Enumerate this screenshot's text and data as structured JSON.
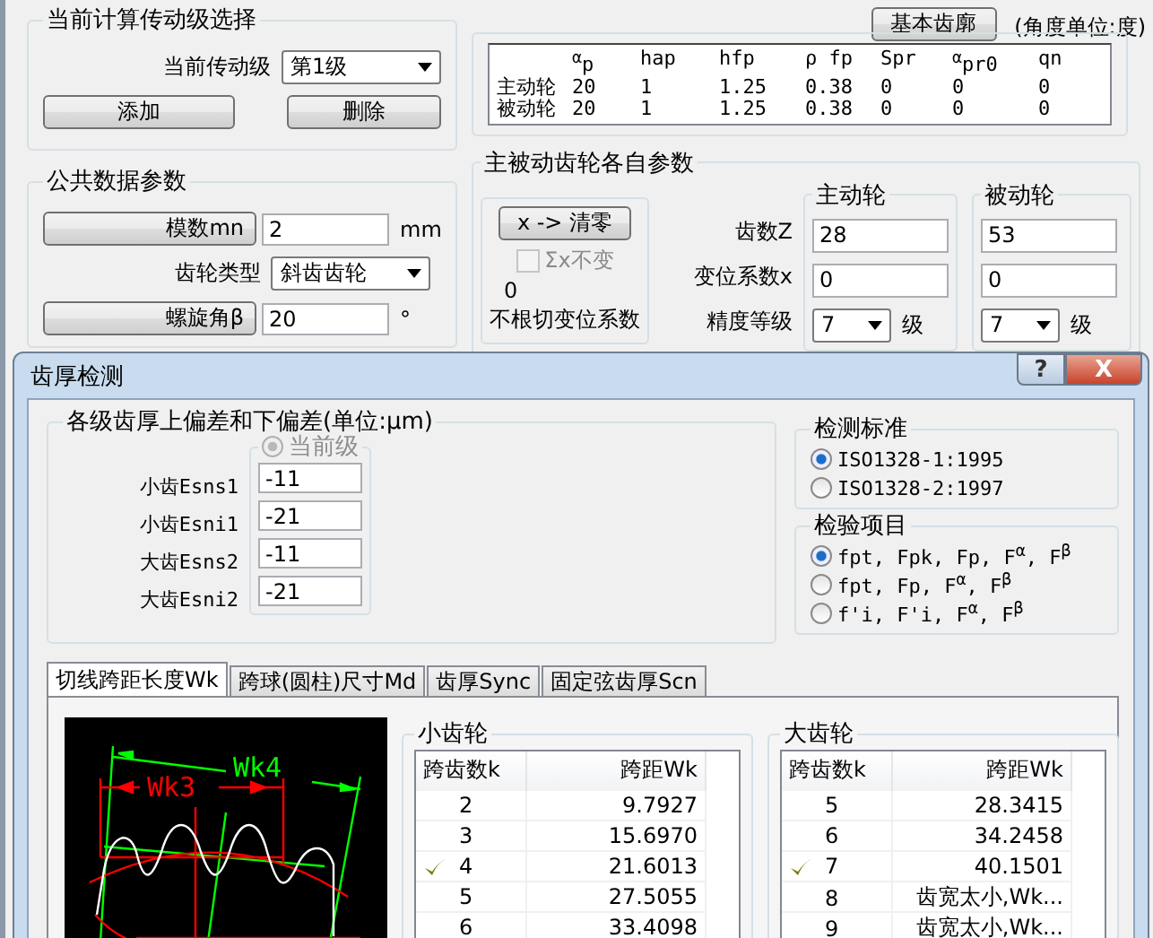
{
  "stage_group": {
    "title": "当前计算传动级选择",
    "stage_label": "当前传动级",
    "stage_value": "第1级",
    "buttons": [
      "添加",
      "删除"
    ]
  },
  "common_params": {
    "title": "公共数据参数",
    "rows": [
      {
        "kind": "button-field",
        "label": "模数mn",
        "value": "2",
        "unit": "mm"
      },
      {
        "kind": "select",
        "label": "齿轮类型",
        "value": "斜齿齿轮"
      },
      {
        "kind": "button-field",
        "label": "螺旋角β",
        "value": "20",
        "unit": "°"
      }
    ]
  },
  "basic_profile": {
    "button": "基本齿廓",
    "unit_note": "(角度单位:度)",
    "columns": [
      "$^{α}$p",
      "hap",
      "hfp",
      "ρ fp",
      "Spr",
      "$^{α}$pr0",
      "qn"
    ],
    "rows": [
      {
        "label": "主动轮",
        "values": [
          "20",
          "1",
          "1.25",
          "0.38",
          "0",
          "0",
          "0"
        ]
      },
      {
        "label": "被动轮",
        "values": [
          "20",
          "1",
          "1.25",
          "0.38",
          "0",
          "0",
          "0"
        ]
      }
    ]
  },
  "gear_params": {
    "title": "主被动齿轮各自参数",
    "clear_button": "x -> 清零",
    "sum_checkbox": {
      "label": "Σx不变",
      "checked": false,
      "disabled": true
    },
    "sum_value": "0",
    "undercut_label": "不根切变位系数",
    "columns": [
      "主动轮",
      "被动轮"
    ],
    "rows": [
      {
        "kind": "input",
        "label": "齿数Z",
        "values": [
          "28",
          "53"
        ]
      },
      {
        "kind": "input",
        "label": "变位系数x",
        "values": [
          "0",
          "0"
        ]
      },
      {
        "kind": "select",
        "label": "精度等级",
        "values": [
          "7",
          "7"
        ],
        "units": [
          "级",
          "级"
        ]
      }
    ]
  },
  "dialog": {
    "title": "齿厚检测",
    "help_button": "?",
    "close_button": "X",
    "deviation_group": {
      "title": "各级齿厚上偏差和下偏差(单位:μm)",
      "level_radio": {
        "label": "当前级",
        "selected": true,
        "disabled": true
      },
      "fields": [
        {
          "label": "小齿Esns1",
          "value": "-11"
        },
        {
          "label": "小齿Esni1",
          "value": "-21"
        },
        {
          "label": "大齿Esns2",
          "value": "-11"
        },
        {
          "label": "大齿Esni2",
          "value": "-21"
        }
      ]
    },
    "standard_group": {
      "title": "检测标准",
      "options": [
        {
          "label": "ISO1328-1:1995",
          "selected": true
        },
        {
          "label": "ISO1328-2:1997",
          "selected": false
        }
      ]
    },
    "items_group": {
      "title": "检验项目",
      "options": [
        {
          "label": "fpt, Fpk, Fp, F$^{α}$, F$^{β}$",
          "selected": true
        },
        {
          "label": "fpt, Fp, F$^{α}$, F$^{β}$",
          "selected": false
        },
        {
          "label": "f'i, F'i, F$^{α}$, F$^{β}$",
          "selected": false
        }
      ]
    },
    "tabs": [
      {
        "label": "切线跨距长度Wk",
        "selected": true
      },
      {
        "label": "跨球(圆柱)尺寸Md",
        "selected": false
      },
      {
        "label": "齿厚Sync",
        "selected": false
      },
      {
        "label": "固定弦齿厚Scn",
        "selected": false
      }
    ],
    "diagram_labels": [
      "Wk4",
      "Wk3"
    ],
    "gear_tables": [
      {
        "title": "小齿轮",
        "columns": [
          "跨齿数k",
          "跨距Wk"
        ],
        "rows": [
          {
            "k": "2",
            "wk": "9.7927",
            "checked": false
          },
          {
            "k": "3",
            "wk": "15.6970",
            "checked": false
          },
          {
            "k": "4",
            "wk": "21.6013",
            "checked": true
          },
          {
            "k": "5",
            "wk": "27.5055",
            "checked": false
          },
          {
            "k": "6",
            "wk": "33.4098",
            "checked": false
          }
        ]
      },
      {
        "title": "大齿轮",
        "columns": [
          "跨齿数k",
          "跨距Wk"
        ],
        "rows": [
          {
            "k": "5",
            "wk": "28.3415",
            "checked": false
          },
          {
            "k": "6",
            "wk": "34.2458",
            "checked": false
          },
          {
            "k": "7",
            "wk": "40.1501",
            "checked": true
          },
          {
            "k": "8",
            "wk": "齿宽太小,Wk...",
            "checked": false
          },
          {
            "k": "9",
            "wk": "齿宽太小,Wk...",
            "checked": false
          }
        ]
      }
    ]
  }
}
